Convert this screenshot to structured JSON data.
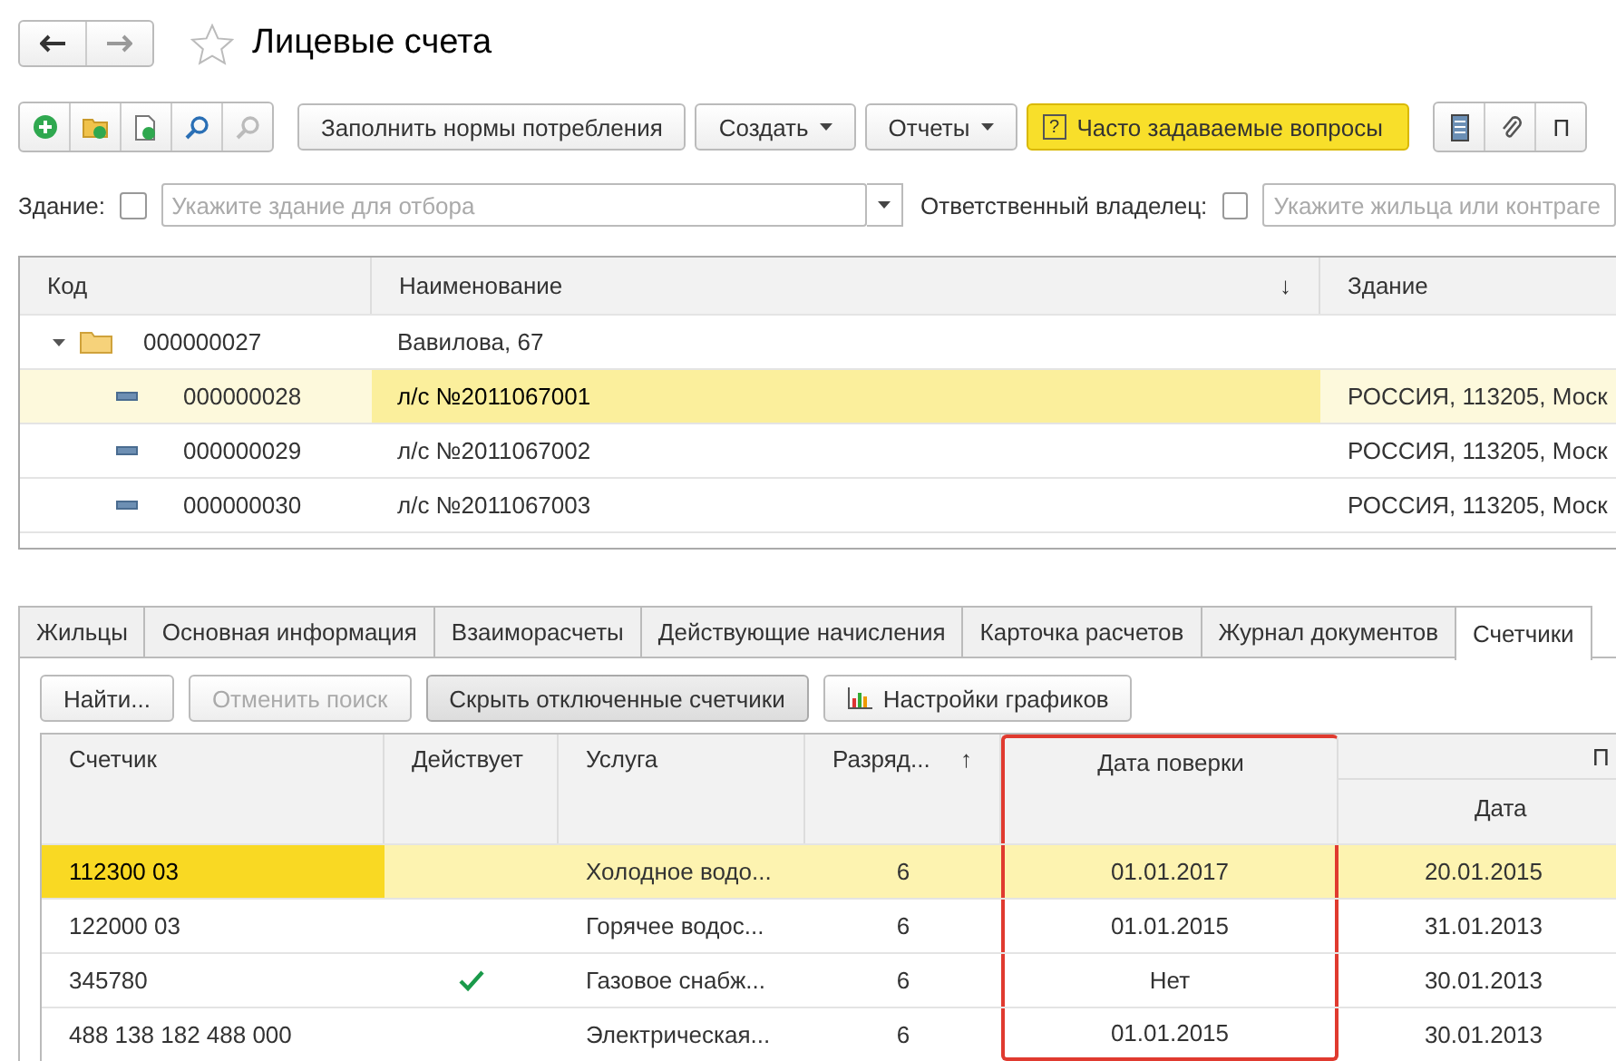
{
  "window": {
    "title": "Лицевые счета",
    "favorite": false
  },
  "toolbar": {
    "buttons": [
      {
        "kind": "text",
        "label": "Заполнить нормы потребления"
      },
      {
        "kind": "menu",
        "label": "Создать"
      },
      {
        "kind": "menu",
        "label": "Отчеты"
      },
      {
        "kind": "help",
        "label": "Часто задаваемые вопросы",
        "icon": "?"
      }
    ],
    "right_label": "П"
  },
  "filters": [
    {
      "label": "Здание:",
      "checked": false,
      "placeholder": "Укажите здание для отбора",
      "dropdown": true
    },
    {
      "label": "Ответственный владелец:",
      "checked": false,
      "placeholder": "Укажите жильца или контраге",
      "dropdown": false
    }
  ],
  "accounts": {
    "columns": [
      {
        "label": "Код"
      },
      {
        "label": "Наименование",
        "sort": "↓"
      },
      {
        "label": "Здание"
      }
    ],
    "rows": [
      {
        "code": "000000027",
        "name": "Вавилова, 67",
        "expanded": true,
        "selected": false,
        "children": [
          {
            "code": "000000028",
            "name": "л/с №2011067001",
            "building": "РОССИЯ, 113205, Моск",
            "selected": true
          },
          {
            "code": "000000029",
            "name": "л/с №2011067002",
            "building": "РОССИЯ, 113205, Моск",
            "selected": false
          },
          {
            "code": "000000030",
            "name": "л/с №2011067003",
            "building": "РОССИЯ, 113205, Моск",
            "selected": false
          }
        ]
      }
    ]
  },
  "tabs": [
    {
      "label": "Жильцы",
      "selected": false
    },
    {
      "label": "Основная информация",
      "selected": false
    },
    {
      "label": "Взаиморасчеты",
      "selected": false
    },
    {
      "label": "Действующие начисления",
      "selected": false
    },
    {
      "label": "Карточка расчетов",
      "selected": false
    },
    {
      "label": "Журнал документов",
      "selected": false
    },
    {
      "label": "Счетчики",
      "selected": true
    }
  ],
  "meter_buttons": [
    {
      "label": "Найти...",
      "disabled": false,
      "pressed": false,
      "icon": false
    },
    {
      "label": "Отменить поиск",
      "disabled": true,
      "pressed": false,
      "icon": false
    },
    {
      "label": "Скрыть отключенные счетчики",
      "disabled": false,
      "pressed": true,
      "icon": false
    },
    {
      "label": "Настройки графиков",
      "disabled": false,
      "pressed": false,
      "icon": true
    }
  ],
  "meters": {
    "columns": [
      {
        "label": "Счетчик",
        "highlighted": false
      },
      {
        "label": "Действует",
        "highlighted": false
      },
      {
        "label": "Услуга",
        "highlighted": false
      },
      {
        "label": "Разряд...",
        "sort": "↑",
        "highlighted": false
      },
      {
        "label": "Дата поверки",
        "highlighted": true
      }
    ],
    "group_column": {
      "label": "П",
      "sub": "Дата"
    },
    "rows": [
      {
        "meter": "112300 03",
        "active": false,
        "service": "Холодное водо...",
        "digits": "6",
        "check_date": "01.01.2017",
        "date": "20.01.2015",
        "selected": true
      },
      {
        "meter": "122000 03",
        "active": false,
        "service": "Горячее водос...",
        "digits": "6",
        "check_date": "01.01.2015",
        "date": "31.01.2013",
        "selected": false
      },
      {
        "meter": "345780",
        "active": true,
        "service": "Газовое снабж...",
        "digits": "6",
        "check_date": "Нет",
        "date": "30.01.2013",
        "selected": false
      },
      {
        "meter": "488 138 182 488 000",
        "active": false,
        "service": "Электрическая...",
        "digits": "6",
        "check_date": "01.01.2015",
        "date": "30.01.2013",
        "selected": false
      }
    ]
  }
}
